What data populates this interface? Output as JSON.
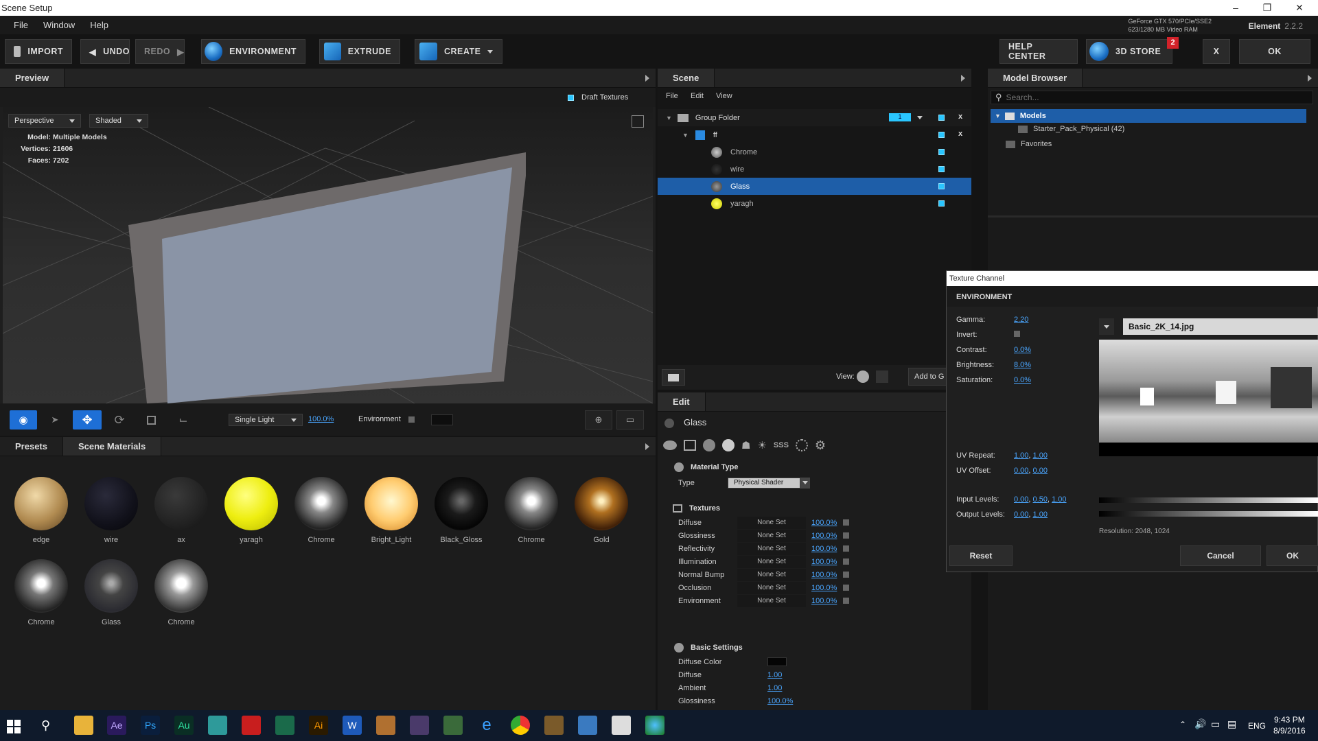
{
  "window": {
    "title": "Scene Setup"
  },
  "menu": [
    "File",
    "Window",
    "Help"
  ],
  "gpu": {
    "line1": "GeForce GTX 570/PCIe/SSE2",
    "line2": "623/1280 MB Video RAM"
  },
  "app": {
    "name": "Element",
    "version": "2.2.2"
  },
  "toolbar": {
    "import": "IMPORT",
    "undo": "UNDO",
    "redo": "REDO",
    "environment": "ENVIRONMENT",
    "extrude": "EXTRUDE",
    "create": "CREATE",
    "help": "HELP CENTER",
    "store": "3D STORE",
    "store_badge": "2",
    "close": "X",
    "ok": "OK"
  },
  "preview": {
    "tab": "Preview",
    "draft": "Draft Textures",
    "view": "Perspective",
    "shading": "Shaded",
    "model_label": "Model:",
    "model": "Multiple Models",
    "vert_label": "Vertices:",
    "vertices": "21606",
    "faces_label": "Faces:",
    "faces": "7202",
    "light": "Single Light",
    "light_pct": "100.0%",
    "env": "Environment"
  },
  "presets": {
    "tabs": [
      "Presets",
      "Scene Materials"
    ],
    "materials": [
      {
        "name": "edge",
        "color": "radial-gradient(circle at 40% 35%,#f0d9a8,#b08a50 55%,#5a4020)"
      },
      {
        "name": "wire",
        "color": "radial-gradient(circle at 40% 35%,#2a2a3a,#11111a 60%,#050508)"
      },
      {
        "name": "ax",
        "color": "radial-gradient(circle at 40% 35%,#3a3a3a,#222 60%,#111)"
      },
      {
        "name": "yaragh",
        "color": "radial-gradient(circle at 40% 35%,#ffff80,#eeee10 50%,#b8b800)"
      },
      {
        "name": "Chrome",
        "color": "radial-gradient(circle at 50% 45%,#fff 10%,#888 30%,#222 70%,#999)"
      },
      {
        "name": "Bright_Light",
        "color": "radial-gradient(circle at 50% 45%,#fff8d0,#ffcc70 50%,#d08020)"
      },
      {
        "name": "Black_Gloss",
        "color": "radial-gradient(circle at 50% 45%,#666 5%,#1a1a1a 35%,#050505 70%,#333)"
      },
      {
        "name": "Chrome",
        "color": "radial-gradient(circle at 50% 45%,#fff 10%,#888 30%,#222 70%,#aaa)"
      },
      {
        "name": "Gold",
        "color": "radial-gradient(circle at 50% 45%,#fff0c0 5%,#b07020 30%,#402008 70%,#a06828)"
      },
      {
        "name": "Chrome",
        "color": "radial-gradient(circle at 50% 45%,#fff 10%,#777 30%,#222 70%,#999)"
      },
      {
        "name": "Glass",
        "color": "radial-gradient(circle at 50% 45%,#aaa 5%,#444 30%,#2a2a30 70%,#555)"
      },
      {
        "name": "Chrome",
        "color": "radial-gradient(circle at 50% 45%,#fff 12%,#999 30%,#333 70%,#ccc)"
      }
    ]
  },
  "scene": {
    "tab": "Scene",
    "menu": [
      "File",
      "Edit",
      "View"
    ],
    "group": "Group Folder",
    "group_val": "1",
    "sub": "ff",
    "items": [
      {
        "name": "Chrome",
        "selected": false
      },
      {
        "name": "wire",
        "selected": false
      },
      {
        "name": "Glass",
        "selected": true
      },
      {
        "name": "yaragh",
        "selected": false
      }
    ],
    "view_label": "View:",
    "add_to": "Add to G"
  },
  "edit": {
    "tab": "Edit",
    "material": "Glass",
    "mat_type": "Material Type",
    "type_label": "Type",
    "type_value": "Physical Shader",
    "textures_title": "Textures",
    "textures": [
      {
        "name": "Diffuse",
        "value": "None Set",
        "pct": "100.0%"
      },
      {
        "name": "Glossiness",
        "value": "None Set",
        "pct": "100.0%"
      },
      {
        "name": "Reflectivity",
        "value": "None Set",
        "pct": "100.0%"
      },
      {
        "name": "Illumination",
        "value": "None Set",
        "pct": "100.0%"
      },
      {
        "name": "Normal Bump",
        "value": "None Set",
        "pct": "100.0%"
      },
      {
        "name": "Occlusion",
        "value": "None Set",
        "pct": "100.0%"
      },
      {
        "name": "Environment",
        "value": "None Set",
        "pct": "100.0%"
      }
    ],
    "basic_title": "Basic Settings",
    "basic": [
      {
        "name": "Diffuse Color",
        "value": ""
      },
      {
        "name": "Diffuse",
        "value": "1.00"
      },
      {
        "name": "Ambient",
        "value": "1.00"
      },
      {
        "name": "Glossiness",
        "value": "100.0%"
      }
    ]
  },
  "browser": {
    "tab": "Model Browser",
    "search_placeholder": "Search...",
    "models": "Models",
    "pack": "Starter_Pack_Physical (42)",
    "favorites": "Favorites"
  },
  "dialog": {
    "title": "Texture Channel",
    "section": "ENVIRONMENT",
    "gamma_l": "Gamma:",
    "gamma": "2.20",
    "invert_l": "Invert:",
    "contrast_l": "Contrast:",
    "contrast": "0.0%",
    "brightness_l": "Brightness:",
    "brightness": "8.0%",
    "saturation_l": "Saturation:",
    "saturation": "0.0%",
    "file": "Basic_2K_14.jpg",
    "uvrep_l": "UV Repeat:",
    "uvrep1": "1.00",
    "uvrep2": "1.00",
    "uvoff_l": "UV Offset:",
    "uvoff1": "0.00",
    "uvoff2": "0.00",
    "in_l": "Input Levels:",
    "in1": "0.00",
    "in2": "0.50",
    "in3": "1.00",
    "out_l": "Output Levels:",
    "out1": "0.00",
    "out2": "1.00",
    "resolution": "Resolution: 2048, 1024",
    "reset": "Reset",
    "cancel": "Cancel",
    "ok": "OK"
  },
  "taskbar": {
    "time": "9:43 PM",
    "date": "8/9/2016",
    "lang": "ENG"
  }
}
